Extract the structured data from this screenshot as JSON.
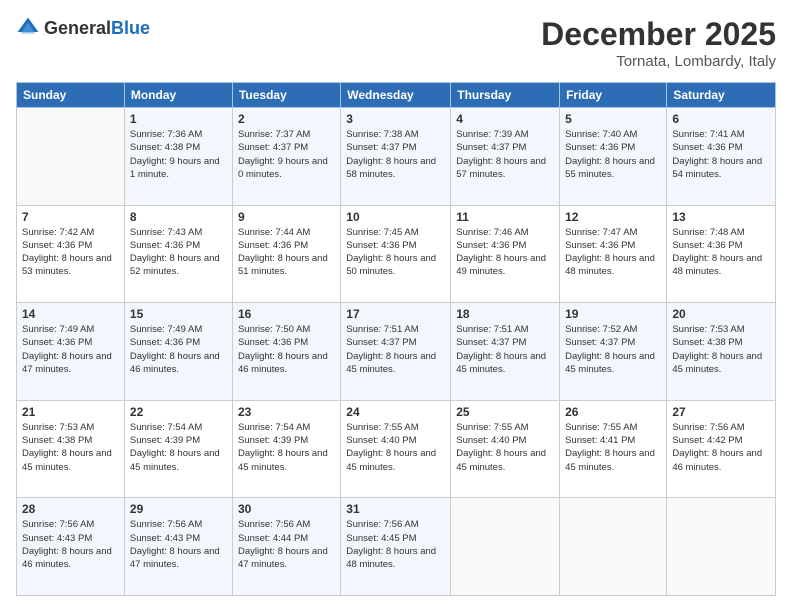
{
  "header": {
    "logo_general": "General",
    "logo_blue": "Blue",
    "month": "December 2025",
    "location": "Tornata, Lombardy, Italy"
  },
  "days_of_week": [
    "Sunday",
    "Monday",
    "Tuesday",
    "Wednesday",
    "Thursday",
    "Friday",
    "Saturday"
  ],
  "weeks": [
    [
      {
        "day": "",
        "sunrise": "",
        "sunset": "",
        "daylight": ""
      },
      {
        "day": "1",
        "sunrise": "Sunrise: 7:36 AM",
        "sunset": "Sunset: 4:38 PM",
        "daylight": "Daylight: 9 hours and 1 minute."
      },
      {
        "day": "2",
        "sunrise": "Sunrise: 7:37 AM",
        "sunset": "Sunset: 4:37 PM",
        "daylight": "Daylight: 9 hours and 0 minutes."
      },
      {
        "day": "3",
        "sunrise": "Sunrise: 7:38 AM",
        "sunset": "Sunset: 4:37 PM",
        "daylight": "Daylight: 8 hours and 58 minutes."
      },
      {
        "day": "4",
        "sunrise": "Sunrise: 7:39 AM",
        "sunset": "Sunset: 4:37 PM",
        "daylight": "Daylight: 8 hours and 57 minutes."
      },
      {
        "day": "5",
        "sunrise": "Sunrise: 7:40 AM",
        "sunset": "Sunset: 4:36 PM",
        "daylight": "Daylight: 8 hours and 55 minutes."
      },
      {
        "day": "6",
        "sunrise": "Sunrise: 7:41 AM",
        "sunset": "Sunset: 4:36 PM",
        "daylight": "Daylight: 8 hours and 54 minutes."
      }
    ],
    [
      {
        "day": "7",
        "sunrise": "Sunrise: 7:42 AM",
        "sunset": "Sunset: 4:36 PM",
        "daylight": "Daylight: 8 hours and 53 minutes."
      },
      {
        "day": "8",
        "sunrise": "Sunrise: 7:43 AM",
        "sunset": "Sunset: 4:36 PM",
        "daylight": "Daylight: 8 hours and 52 minutes."
      },
      {
        "day": "9",
        "sunrise": "Sunrise: 7:44 AM",
        "sunset": "Sunset: 4:36 PM",
        "daylight": "Daylight: 8 hours and 51 minutes."
      },
      {
        "day": "10",
        "sunrise": "Sunrise: 7:45 AM",
        "sunset": "Sunset: 4:36 PM",
        "daylight": "Daylight: 8 hours and 50 minutes."
      },
      {
        "day": "11",
        "sunrise": "Sunrise: 7:46 AM",
        "sunset": "Sunset: 4:36 PM",
        "daylight": "Daylight: 8 hours and 49 minutes."
      },
      {
        "day": "12",
        "sunrise": "Sunrise: 7:47 AM",
        "sunset": "Sunset: 4:36 PM",
        "daylight": "Daylight: 8 hours and 48 minutes."
      },
      {
        "day": "13",
        "sunrise": "Sunrise: 7:48 AM",
        "sunset": "Sunset: 4:36 PM",
        "daylight": "Daylight: 8 hours and 48 minutes."
      }
    ],
    [
      {
        "day": "14",
        "sunrise": "Sunrise: 7:49 AM",
        "sunset": "Sunset: 4:36 PM",
        "daylight": "Daylight: 8 hours and 47 minutes."
      },
      {
        "day": "15",
        "sunrise": "Sunrise: 7:49 AM",
        "sunset": "Sunset: 4:36 PM",
        "daylight": "Daylight: 8 hours and 46 minutes."
      },
      {
        "day": "16",
        "sunrise": "Sunrise: 7:50 AM",
        "sunset": "Sunset: 4:36 PM",
        "daylight": "Daylight: 8 hours and 46 minutes."
      },
      {
        "day": "17",
        "sunrise": "Sunrise: 7:51 AM",
        "sunset": "Sunset: 4:37 PM",
        "daylight": "Daylight: 8 hours and 45 minutes."
      },
      {
        "day": "18",
        "sunrise": "Sunrise: 7:51 AM",
        "sunset": "Sunset: 4:37 PM",
        "daylight": "Daylight: 8 hours and 45 minutes."
      },
      {
        "day": "19",
        "sunrise": "Sunrise: 7:52 AM",
        "sunset": "Sunset: 4:37 PM",
        "daylight": "Daylight: 8 hours and 45 minutes."
      },
      {
        "day": "20",
        "sunrise": "Sunrise: 7:53 AM",
        "sunset": "Sunset: 4:38 PM",
        "daylight": "Daylight: 8 hours and 45 minutes."
      }
    ],
    [
      {
        "day": "21",
        "sunrise": "Sunrise: 7:53 AM",
        "sunset": "Sunset: 4:38 PM",
        "daylight": "Daylight: 8 hours and 45 minutes."
      },
      {
        "day": "22",
        "sunrise": "Sunrise: 7:54 AM",
        "sunset": "Sunset: 4:39 PM",
        "daylight": "Daylight: 8 hours and 45 minutes."
      },
      {
        "day": "23",
        "sunrise": "Sunrise: 7:54 AM",
        "sunset": "Sunset: 4:39 PM",
        "daylight": "Daylight: 8 hours and 45 minutes."
      },
      {
        "day": "24",
        "sunrise": "Sunrise: 7:55 AM",
        "sunset": "Sunset: 4:40 PM",
        "daylight": "Daylight: 8 hours and 45 minutes."
      },
      {
        "day": "25",
        "sunrise": "Sunrise: 7:55 AM",
        "sunset": "Sunset: 4:40 PM",
        "daylight": "Daylight: 8 hours and 45 minutes."
      },
      {
        "day": "26",
        "sunrise": "Sunrise: 7:55 AM",
        "sunset": "Sunset: 4:41 PM",
        "daylight": "Daylight: 8 hours and 45 minutes."
      },
      {
        "day": "27",
        "sunrise": "Sunrise: 7:56 AM",
        "sunset": "Sunset: 4:42 PM",
        "daylight": "Daylight: 8 hours and 46 minutes."
      }
    ],
    [
      {
        "day": "28",
        "sunrise": "Sunrise: 7:56 AM",
        "sunset": "Sunset: 4:43 PM",
        "daylight": "Daylight: 8 hours and 46 minutes."
      },
      {
        "day": "29",
        "sunrise": "Sunrise: 7:56 AM",
        "sunset": "Sunset: 4:43 PM",
        "daylight": "Daylight: 8 hours and 47 minutes."
      },
      {
        "day": "30",
        "sunrise": "Sunrise: 7:56 AM",
        "sunset": "Sunset: 4:44 PM",
        "daylight": "Daylight: 8 hours and 47 minutes."
      },
      {
        "day": "31",
        "sunrise": "Sunrise: 7:56 AM",
        "sunset": "Sunset: 4:45 PM",
        "daylight": "Daylight: 8 hours and 48 minutes."
      },
      {
        "day": "",
        "sunrise": "",
        "sunset": "",
        "daylight": ""
      },
      {
        "day": "",
        "sunrise": "",
        "sunset": "",
        "daylight": ""
      },
      {
        "day": "",
        "sunrise": "",
        "sunset": "",
        "daylight": ""
      }
    ]
  ]
}
